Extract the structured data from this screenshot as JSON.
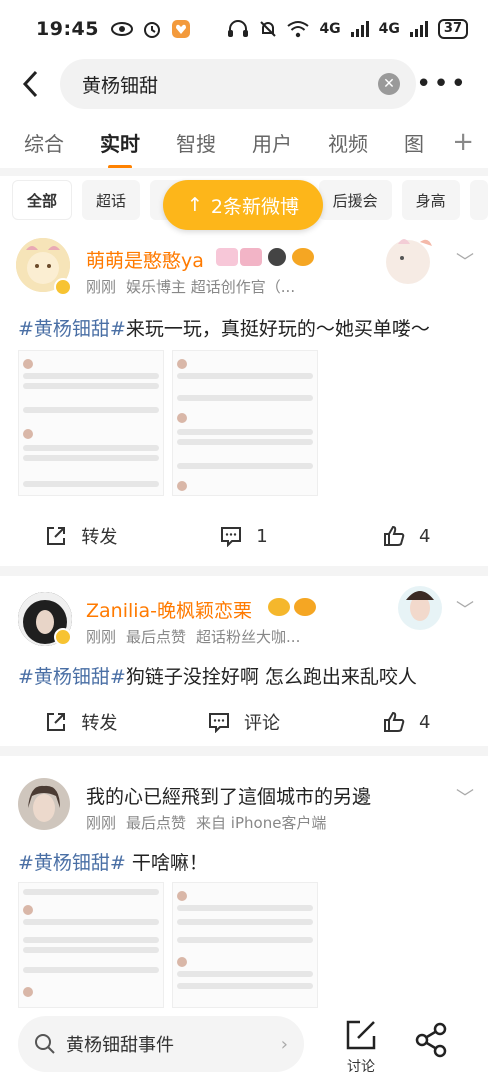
{
  "status": {
    "time": "19:45",
    "battery": "37",
    "net1": "4G",
    "net2": "4G"
  },
  "search": {
    "query": "黄杨钿甜"
  },
  "tabs": [
    "综合",
    "实时",
    "智搜",
    "用户",
    "视频",
    "图"
  ],
  "tab_plus": "+",
  "chips": [
    "全部",
    "超话",
    "后援会",
    "身高"
  ],
  "new_posts_button": "2条新微博",
  "posts": [
    {
      "user": "萌萌是憨憨ya",
      "meta": [
        "刚刚",
        "娱乐博主 超话创作官（..."
      ],
      "hashtag": "#黄杨钿甜#",
      "text": "来玩一玩，真挺好玩的～她买单喽～",
      "repost": "转发",
      "comments": "1",
      "likes": "4"
    },
    {
      "user": "Zanilia-晚枫颖恋栗",
      "meta": [
        "刚刚",
        "最后点赞",
        "超话粉丝大咖..."
      ],
      "hashtag": "#黄杨钿甜#",
      "text": "狗链子没拴好啊 怎么跑出来乱咬人",
      "repost": "转发",
      "comments": "评论",
      "likes": "4"
    },
    {
      "user": "我的心已經飛到了這個城市的另邊",
      "meta": [
        "刚刚",
        "最后点赞",
        "来自 iPhone客户端"
      ],
      "hashtag": "#黄杨钿甜#",
      "text": " 干啥嘛！"
    }
  ],
  "bottom": {
    "search_text": "黄杨钿甜事件",
    "comment_label": "讨论"
  },
  "colors": {
    "accent": "#ff8200",
    "username": "#ff7a00",
    "hashtag": "#4a6fa5",
    "new_posts_bg": "#fdb61a"
  }
}
